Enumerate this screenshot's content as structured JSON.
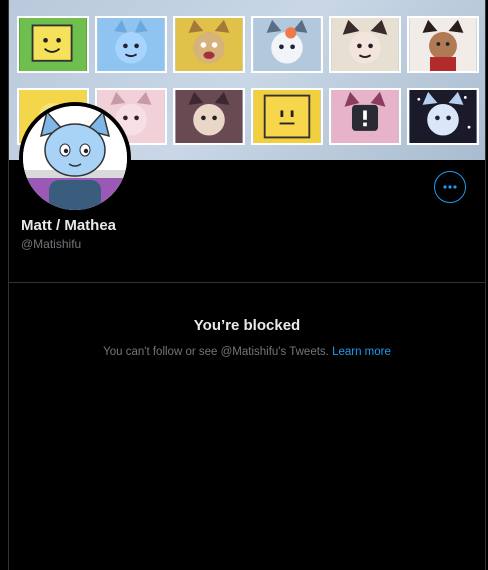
{
  "profile": {
    "display_name": "Matt / Mathea",
    "handle": "@Matishifu"
  },
  "blocked": {
    "title": "You’re blocked",
    "message": "You can't follow or see @Matishifu's Tweets. ",
    "learn_more": "Learn more"
  },
  "icons": {
    "more": "more-horizontal-icon"
  },
  "colors": {
    "accent": "#1d9bf0",
    "background": "#000000",
    "muted_text": "#71767b",
    "border": "#2f3336"
  }
}
